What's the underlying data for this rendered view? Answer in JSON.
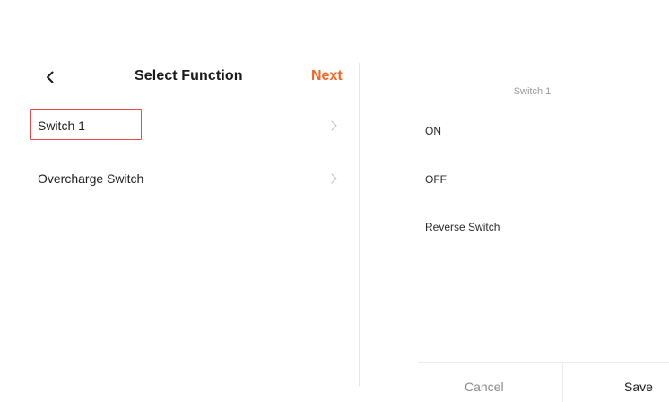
{
  "header": {
    "back_icon": "chevron-left-icon",
    "title": "Select Function",
    "next_label": "Next",
    "accent_color": "#f26522"
  },
  "functions": [
    {
      "label": "Switch 1",
      "icon": "chevron-right-icon",
      "highlighted": true
    },
    {
      "label": "Overcharge Switch",
      "icon": "chevron-right-icon",
      "highlighted": false
    }
  ],
  "highlight_color": "#e84a4a",
  "picker": {
    "title": "Switch 1",
    "options": [
      {
        "label": "ON"
      },
      {
        "label": "OFF"
      },
      {
        "label": "Reverse Switch"
      }
    ],
    "cancel_label": "Cancel",
    "save_label": "Save"
  }
}
